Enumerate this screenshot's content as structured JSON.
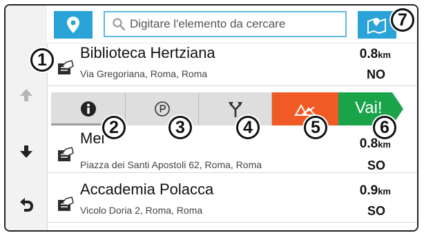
{
  "search": {
    "placeholder": "Digitare l'elemento da cercare"
  },
  "results": [
    {
      "name": "Biblioteca Hertziana",
      "address": "Via Gregoriana, Roma, Roma",
      "distance": "0.8",
      "unit": "km",
      "direction": "NO"
    },
    {
      "name": "Mei",
      "address": "Piazza dei Santi Apostoli 62, Roma, Roma",
      "distance": "0.8",
      "unit": "km",
      "direction": "SO"
    },
    {
      "name": "Accademia Polacca",
      "address": "Vicolo Doria 2, Roma, Roma",
      "distance": "0.9",
      "unit": "km",
      "direction": "SO"
    }
  ],
  "actions": {
    "go_label": "Vai!"
  },
  "callouts": [
    "1",
    "2",
    "3",
    "4",
    "5",
    "6",
    "7"
  ],
  "icons": {
    "pin": "location-pin-icon",
    "search": "search-icon",
    "map": "map-view-icon",
    "up": "arrow-up-icon",
    "down": "arrow-down-icon",
    "back": "back-icon",
    "info": "info-icon",
    "parking": "parking-icon",
    "detour": "fork-icon",
    "route": "route-icon",
    "category": "library-icon"
  },
  "colors": {
    "accent": "#29a3d8",
    "route": "#f05a24",
    "go": "#1aa44a",
    "search_border": "#5fb8e0"
  }
}
